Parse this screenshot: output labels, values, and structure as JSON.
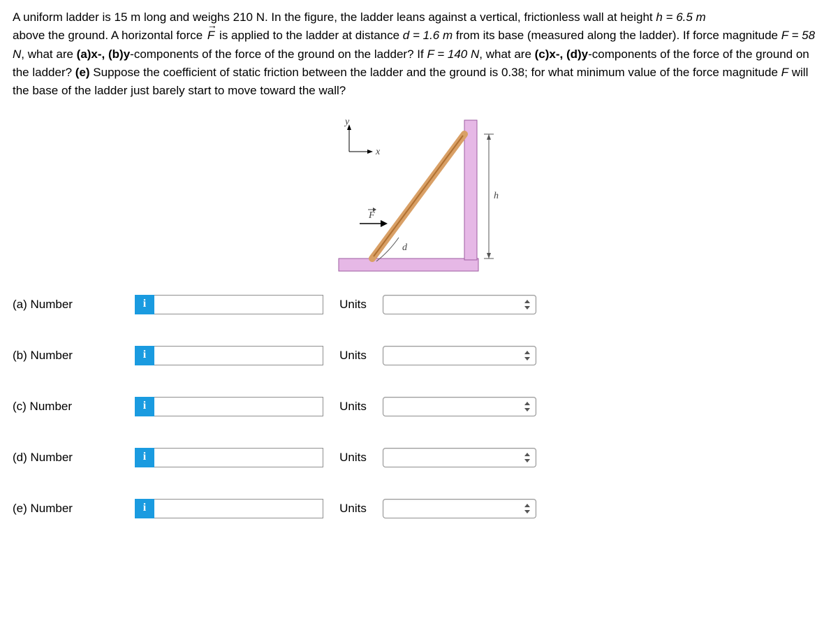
{
  "problem": {
    "p1_pre": "A uniform ladder is 15 m long and weighs 210 N. In the figure, the ladder leans against a vertical, frictionless wall at height ",
    "p1_hval": "h = 6.5 m",
    "p2_a": "above the ground. A horizontal force ",
    "p2_vec": "F",
    "p2_b": " is applied to the ladder at distance ",
    "p2_d": "d = 1.6 m",
    "p2_c": " from its base (measured along the ladder). If force magnitude ",
    "p2_F1": "F = 58 N",
    "p2_e": ", what are ",
    "p2_ax": "(a)x-, (b)y",
    "p2_f": "-components of the force of the ground on the ladder? If ",
    "p2_F2": "F = 140 N",
    "p2_g": ", what are ",
    "p2_cx": "(c)x-, (d)y",
    "p2_h": "-components of the force of the ground on the ladder? ",
    "p2_epre": "(e)",
    "p2_i": " Suppose the coefficient of static friction between the ladder and the ground is 0.38; for what minimum value of the force magnitude ",
    "p2_Fvar": "F",
    "p2_j": " will the base of the ladder just barely start to move toward the wall?"
  },
  "fig": {
    "y": "y",
    "x": "x",
    "F": "F",
    "d": "d",
    "h": "h"
  },
  "rows": [
    {
      "label": "(a)   Number",
      "info": "i",
      "units": "Units"
    },
    {
      "label": "(b)   Number",
      "info": "i",
      "units": "Units"
    },
    {
      "label": "(c)   Number",
      "info": "i",
      "units": "Units"
    },
    {
      "label": "(d)   Number",
      "info": "i",
      "units": "Units"
    },
    {
      "label": "(e)   Number",
      "info": "i",
      "units": "Units"
    }
  ]
}
